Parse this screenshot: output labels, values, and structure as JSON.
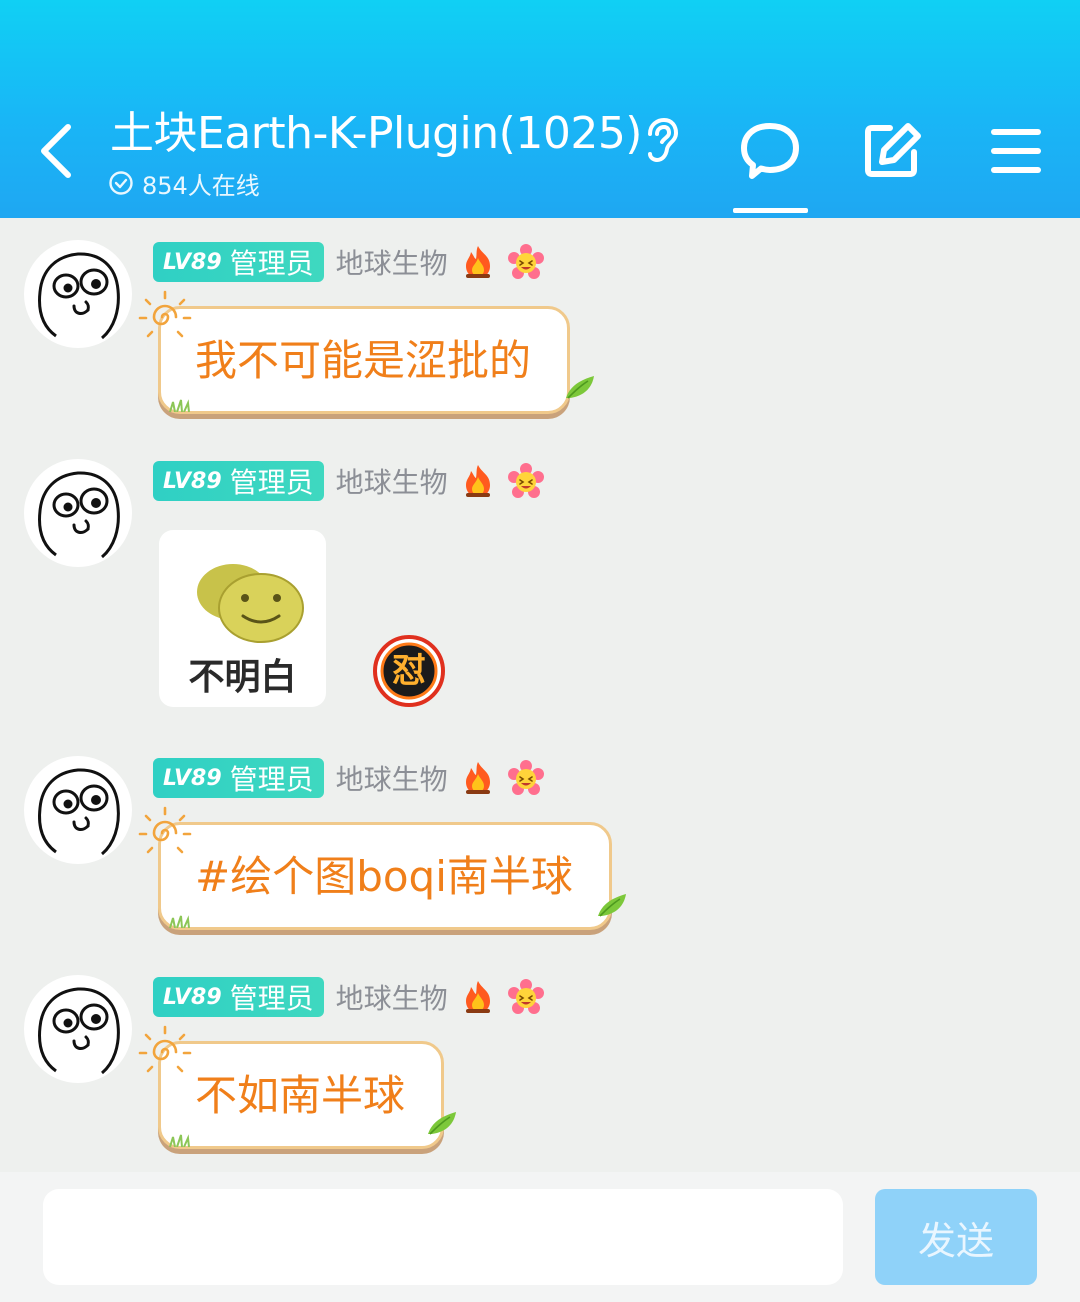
{
  "header": {
    "title": "土块Earth-K-Plugin(1025)",
    "online_text": "854人在线",
    "icons": [
      "back-arrow-icon",
      "ear-icon",
      "chat-bubble-icon",
      "edit-icon",
      "menu-icon"
    ],
    "gradient": [
      "#10d0f4",
      "#1fa7f2"
    ]
  },
  "messages": [
    {
      "badge_level": "LV89",
      "badge_role": "管理员",
      "nickname": "地球生物",
      "text": "我不可能是涩批的"
    },
    {
      "badge_level": "LV89",
      "badge_role": "管理员",
      "nickname": "地球生物",
      "sticker_text": "不明白",
      "reaction_text": "怼"
    },
    {
      "badge_level": "LV89",
      "badge_role": "管理员",
      "nickname": "地球生物",
      "text": "#绘个图boqi南半球"
    },
    {
      "badge_level": "LV89",
      "badge_role": "管理员",
      "nickname": "地球生物",
      "text": "不如南半球"
    }
  ],
  "input": {
    "value": "",
    "send_label": "发送"
  },
  "colors": {
    "bubble_text": "#f07f1a",
    "bubble_border": "#f0c98b",
    "badge": "#2fd0c4",
    "send_button": "#8fd2f9"
  }
}
